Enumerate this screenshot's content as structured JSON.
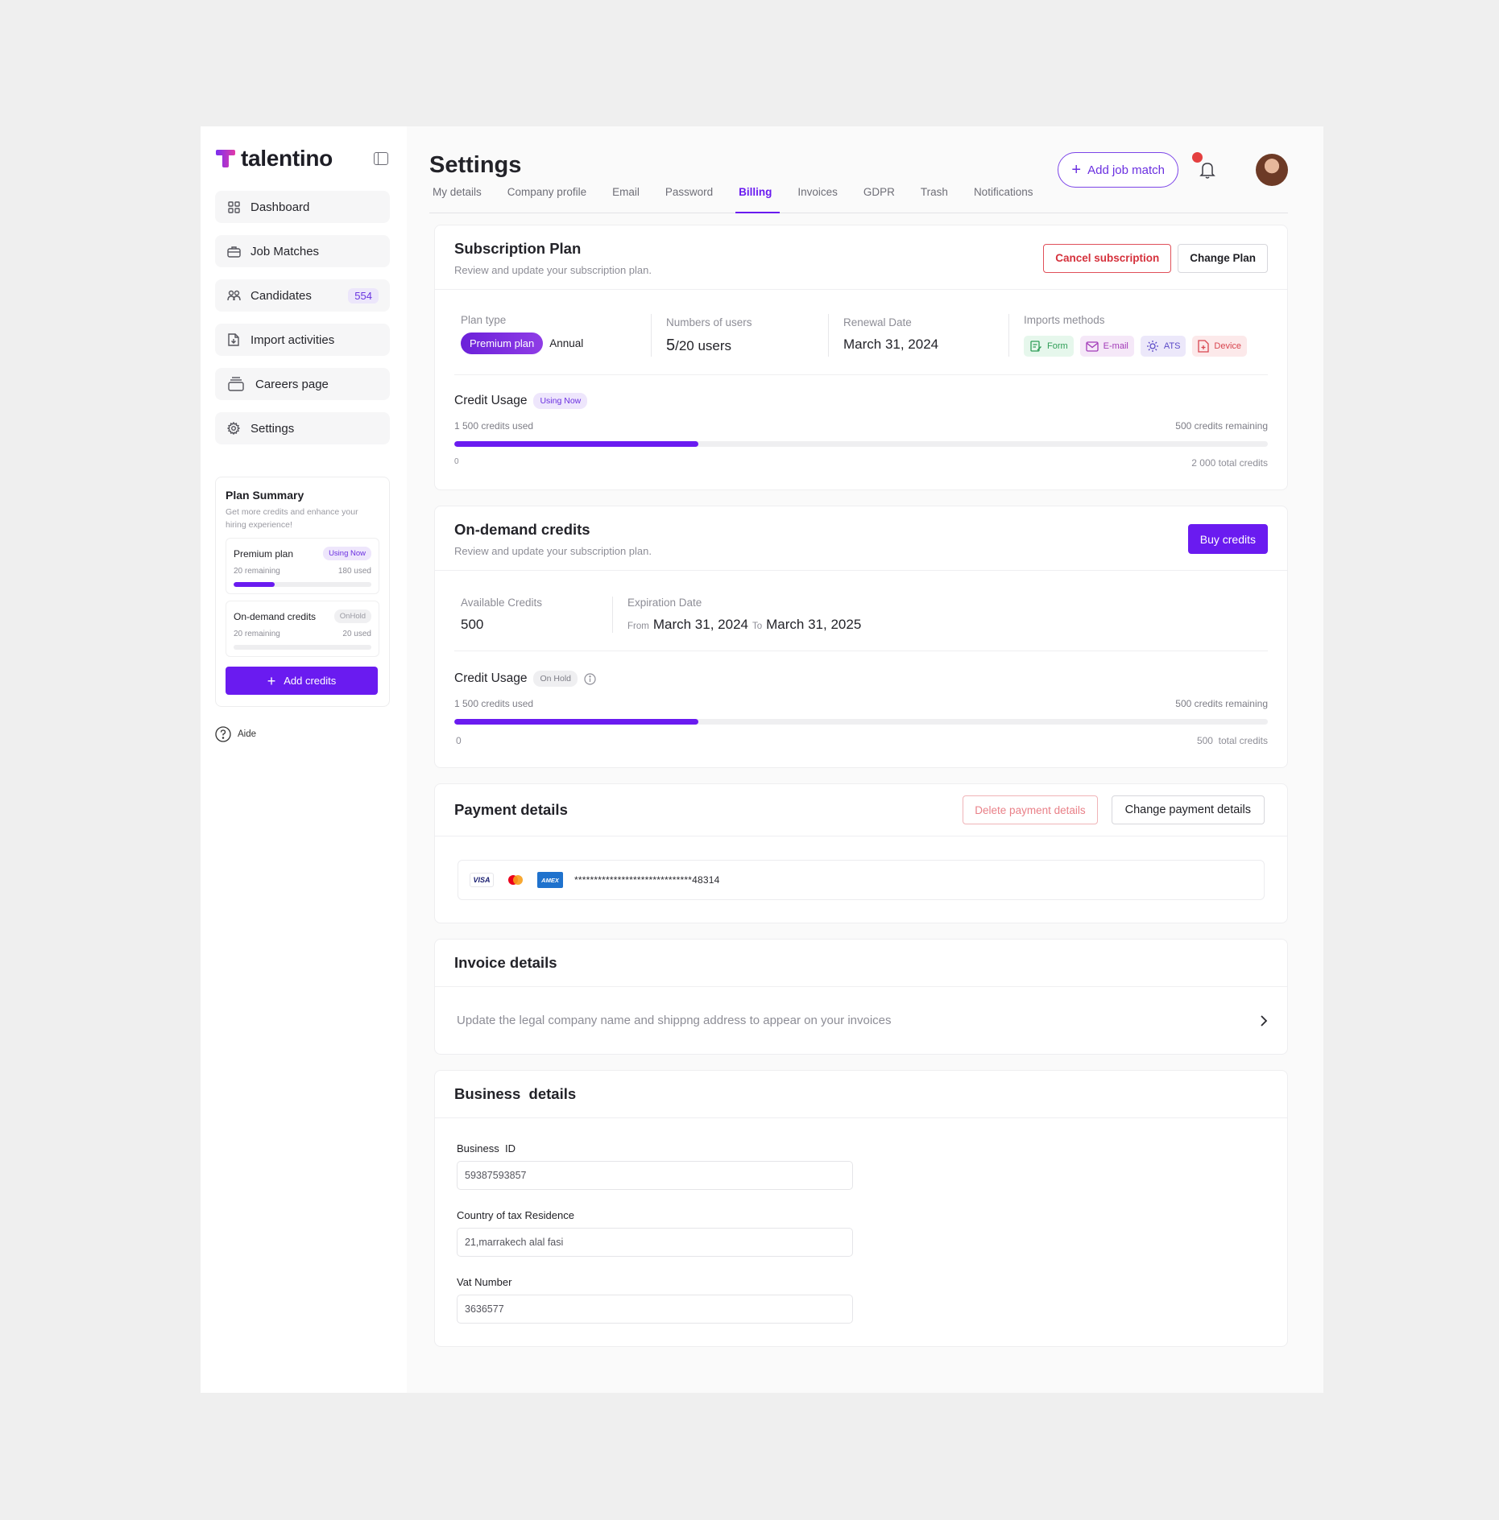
{
  "brand": {
    "name": "talentino",
    "accent": "#6a1bf0"
  },
  "sidebar": {
    "items": [
      {
        "label": "Dashboard",
        "icon": "grid-icon"
      },
      {
        "label": "Job Matches",
        "icon": "briefcase-icon"
      },
      {
        "label": "Candidates",
        "icon": "users-icon",
        "badge": "554"
      },
      {
        "label": "Import activities",
        "icon": "file-import-icon"
      },
      {
        "label": "Careers page",
        "icon": "layers-icon"
      },
      {
        "label": "Settings",
        "icon": "gear-icon"
      }
    ],
    "plan_summary": {
      "title": "Plan Summary",
      "subtitle": "Get more credits and enhance your hiring experience!",
      "plans": [
        {
          "name": "Premium plan",
          "tag": "Using Now",
          "remaining": "20 remaining",
          "used": "180 used",
          "progress_pct": 30
        },
        {
          "name": "On-demand credits",
          "tag": "OnHold",
          "remaining": "20 remaining",
          "used": "20 used",
          "progress_pct": 0
        }
      ],
      "add_credits_label": "Add credits"
    },
    "aide_label": "Aide"
  },
  "header": {
    "title": "Settings",
    "add_job_label": "Add job match"
  },
  "tabs": [
    "My details",
    "Company profile",
    "Email",
    "Password",
    "Billing",
    "Invoices",
    "GDPR",
    "Trash",
    "Notifications"
  ],
  "active_tab": "Billing",
  "subscription": {
    "title": "Subscription Plan",
    "subtitle": "Review and update your subscription plan.",
    "cancel_label": "Cancel subscription",
    "change_label": "Change Plan",
    "plan_type_label": "Plan type",
    "plan_name": "Premium plan",
    "plan_period": "Annual",
    "users_label": "Numbers of users",
    "users_current": "5",
    "users_total": "/20 users",
    "renewal_label": "Renewal Date",
    "renewal_value": "March 31, 2024",
    "imports_label": "Imports methods",
    "methods": [
      {
        "label": "Form",
        "icon": "form-icon"
      },
      {
        "label": "E-mail",
        "icon": "mail-icon"
      },
      {
        "label": "ATS",
        "icon": "ats-icon"
      },
      {
        "label": "Device",
        "icon": "device-file-icon"
      }
    ],
    "usage": {
      "title": "Credit Usage",
      "tag": "Using Now",
      "used": "1 500 credits used",
      "remaining": "500 credits remaining",
      "min": "0",
      "total": "2 000 total credits",
      "progress_pct": 30
    }
  },
  "ondemand": {
    "title": "On-demand credits",
    "subtitle": "Review and update your subscription plan.",
    "buy_label": "Buy credits",
    "available_label": "Available Credits",
    "available_value": "500",
    "expiration_label": "Expiration Date",
    "from_label": "From",
    "from_value": "March 31, 2024",
    "to_label": "To",
    "to_value": "March 31, 2025",
    "usage": {
      "title": "Credit Usage",
      "tag": "On Hold",
      "used": "1 500 credits used",
      "remaining": "500 credits remaining",
      "min": "0",
      "total": "500  total credits",
      "progress_pct": 30
    }
  },
  "payment": {
    "title": "Payment details",
    "delete_label": "Delete payment details",
    "change_label": "Change payment details",
    "visa": "VISA",
    "amex": "AMEX",
    "card_number": "******************************48314"
  },
  "invoice": {
    "title": "Invoice details",
    "description": "Update the legal company name and shippng address to appear on your invoices"
  },
  "business": {
    "title": "Business  details",
    "fields": [
      {
        "label": "Business  ID",
        "value": "59387593857"
      },
      {
        "label": "Country of tax Residence",
        "value": "21,marrakech alal fasi"
      },
      {
        "label": "Vat Number",
        "value": "3636577"
      }
    ]
  }
}
